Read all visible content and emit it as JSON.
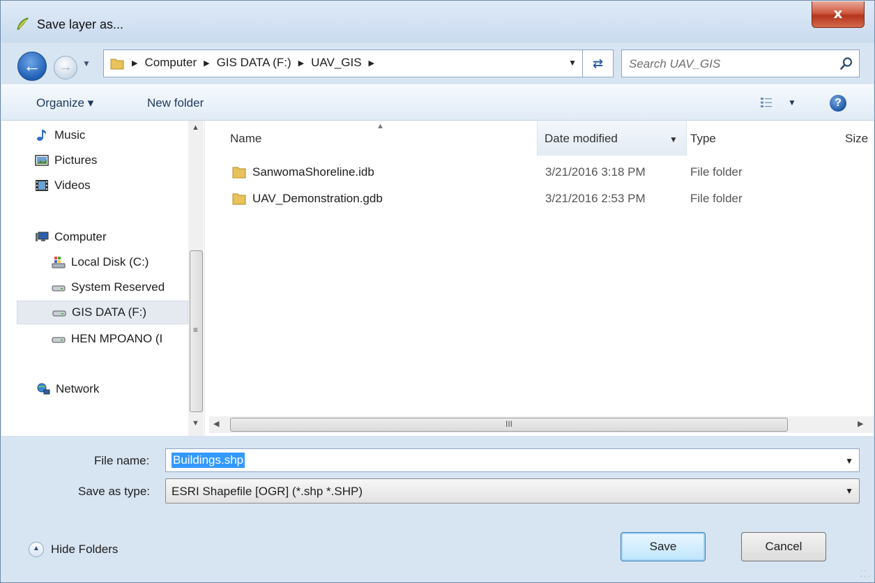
{
  "window": {
    "title": "Save layer as...",
    "close_label": "x",
    "title_icon": "qgis-icon"
  },
  "navigation": {
    "back_icon": "back-arrow-icon",
    "forward_icon": "forward-arrow-icon",
    "breadcrumbs": [
      "Computer",
      "GIS DATA (F:)",
      "UAV_GIS"
    ],
    "search_placeholder": "Search UAV_GIS"
  },
  "toolbar": {
    "organize_label": "Organize ▾",
    "new_folder_label": "New folder",
    "help_label": "?"
  },
  "sidebar": {
    "items": [
      {
        "label": "Music",
        "icon": "music-icon"
      },
      {
        "label": "Pictures",
        "icon": "pictures-icon"
      },
      {
        "label": "Videos",
        "icon": "videos-icon"
      },
      {
        "label": "Computer",
        "icon": "computer-icon"
      },
      {
        "label": "Local Disk (C:)",
        "icon": "local-disk-icon"
      },
      {
        "label": "System Reserved",
        "icon": "drive-icon"
      },
      {
        "label": "GIS DATA (F:)",
        "icon": "drive-icon",
        "selected": true
      },
      {
        "label": "HEN MPOANO (I",
        "icon": "drive-icon"
      },
      {
        "label": "Network",
        "icon": "network-icon"
      }
    ]
  },
  "file_list": {
    "columns": {
      "name": "Name",
      "date": "Date modified",
      "type": "Type",
      "size": "Size"
    },
    "rows": [
      {
        "name": "SanwomaShoreline.idb",
        "date": "3/21/2016 3:18 PM",
        "type": "File folder"
      },
      {
        "name": "UAV_Demonstration.gdb",
        "date": "3/21/2016 2:53 PM",
        "type": "File folder"
      }
    ]
  },
  "form": {
    "file_name_label": "File name:",
    "file_name_value": "Buildings.shp",
    "save_type_label": "Save as type:",
    "save_type_value": "ESRI Shapefile [OGR] (*.shp *.SHP)"
  },
  "footer": {
    "hide_folders_label": "Hide Folders",
    "save_label": "Save",
    "cancel_label": "Cancel"
  },
  "colors": {
    "accent": "#3399ff",
    "frame": "#d7e4f2",
    "close": "#c9482c"
  }
}
